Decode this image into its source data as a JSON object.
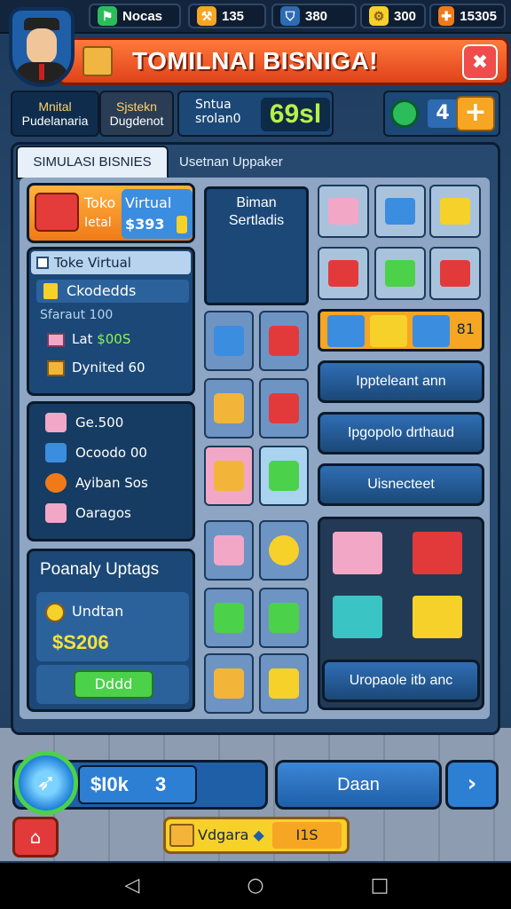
{
  "top_bar": {
    "resources": [
      {
        "icon": "flag-icon",
        "label": "Nocas",
        "color": "#2bbd5b"
      },
      {
        "icon": "hammer-icon",
        "label": "135",
        "color": "#f6a622"
      },
      {
        "icon": "shield-icon",
        "label": "380",
        "color": "#2d6bb2"
      },
      {
        "icon": "gear-icon",
        "label": "300",
        "color": "#f6d12a"
      },
      {
        "icon": "ticket-icon",
        "label": "15305",
        "color": "#f07a18"
      }
    ]
  },
  "header": {
    "title": "TOMILNAI BISNIGA!",
    "close_glyph": "✖"
  },
  "tabs_top": {
    "modal_line1": "Mnital",
    "modal_line2": "Pudelanaria",
    "sys_line1": "Sjstekn",
    "sys_line2": "Dugdenot"
  },
  "stat": {
    "label_line1": "Sntua",
    "label_line2": "srolan0",
    "value": "69sl"
  },
  "plus_group": {
    "count": "4",
    "plus_glyph": "+"
  },
  "main_tabs": {
    "active": "SIMULASI BISNIES",
    "inactive": "Usetnan Uppaker"
  },
  "toko_card": {
    "l1": "Toko",
    "l2": "Ietal",
    "v1": "Virtual",
    "v2": "$393"
  },
  "toko_panel": {
    "head": "Toke Virtual",
    "highlight": "Ckodedds",
    "sub": "Sfaraut 100",
    "r3_label": "Lat",
    "r3_value": "$00S",
    "r4_label": "Dynited 60"
  },
  "list_panel": {
    "items": [
      {
        "label": "Ge.500",
        "color": "#f2a7c7"
      },
      {
        "label": "Ocoodo 00",
        "color": "#3b8de0"
      },
      {
        "label": "Ayiban Sos",
        "color": "#f07a18"
      },
      {
        "label": "Oaragos",
        "color": "#f2a7c7"
      }
    ]
  },
  "upgrade_panel": {
    "title": "Poanaly Uptags",
    "item": "Undtan",
    "price": "$S206",
    "button": "Dddd"
  },
  "serti_card": {
    "line1": "Biman",
    "line2": "Sertladis"
  },
  "mid_grid": {
    "items": [
      {
        "name": "blue-bin",
        "color": "#3b8de0"
      },
      {
        "name": "fruit-basket",
        "color": "#e23a3a"
      },
      {
        "name": "produce-crate",
        "color": "#f2b53a"
      },
      {
        "name": "red-crate",
        "color": "#e23a3a"
      },
      {
        "name": "cardboard-box",
        "color": "#f2b53a"
      },
      {
        "name": "green-basket",
        "color": "#4cd14a"
      },
      {
        "name": "pink-cushion",
        "color": "#f2a7c7"
      },
      {
        "name": "gold-nut",
        "color": "#f6d12a"
      },
      {
        "name": "green-cart",
        "color": "#4cd14a"
      },
      {
        "name": "green-crate",
        "color": "#4cd14a"
      },
      {
        "name": "wooden-box",
        "color": "#f2b53a"
      },
      {
        "name": "gold-tag",
        "color": "#f6d12a"
      }
    ]
  },
  "right_grid": {
    "items": [
      {
        "name": "cart-pink",
        "color": "#f2a7c7"
      },
      {
        "name": "cart-display",
        "color": "#3b8de0"
      },
      {
        "name": "shelf-items",
        "color": "#f6d12a"
      },
      {
        "name": "cart-red",
        "color": "#e23a3a"
      },
      {
        "name": "poster",
        "color": "#4cd14a"
      },
      {
        "name": "cart-green",
        "color": "#e23a3a"
      }
    ]
  },
  "orange_row": {
    "text": "81"
  },
  "action_buttons": [
    {
      "label": "Ippteleant ann"
    },
    {
      "label": "Ipgopolo drthaud"
    },
    {
      "label": "Uisnecteet"
    }
  ],
  "shop_panel": {
    "button": "Uropaole itb anc"
  },
  "bottom": {
    "price_label": "$I0k",
    "price_num": "3",
    "daan": "Daan",
    "next_glyph": "›",
    "info_label": "Vdgara",
    "info_diamond": "◆",
    "info_value": "I1S"
  }
}
